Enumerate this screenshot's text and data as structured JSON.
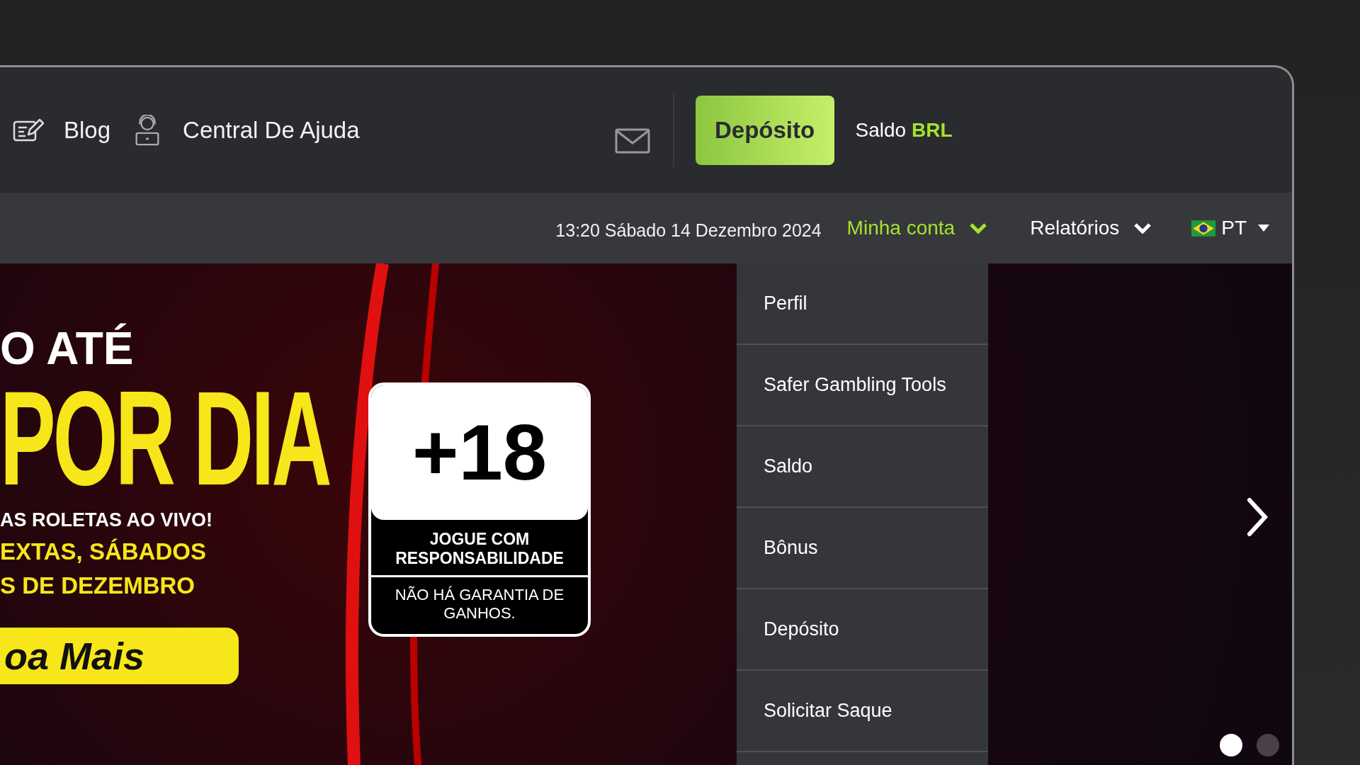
{
  "header": {
    "links": [
      {
        "label": "Blog"
      },
      {
        "label": "Central De Ajuda"
      }
    ],
    "deposit_button": "Depósito",
    "balance": {
      "label": "Saldo",
      "currency": "BRL"
    }
  },
  "subnav": {
    "datetime": "13:20 Sábado 14 Dezembro 2024",
    "menus": [
      {
        "label": "Minha conta",
        "selected": true
      },
      {
        "label": "Relatórios",
        "selected": false
      }
    ],
    "language": "PT"
  },
  "account_menu": {
    "items": [
      "Perfil",
      "Safer Gambling Tools",
      "Saldo",
      "Bônus",
      "Depósito",
      "Solicitar Saque"
    ]
  },
  "banner": {
    "headline": "O ATÉ",
    "amount_line": "POR DIA",
    "subtitle": "AS ROLETAS AO VIVO!",
    "dates": [
      "EXTAS, SÁBADOS",
      "S DE DEZEMBRO"
    ],
    "cta": "oa Mais",
    "age_badge": {
      "age": "+18",
      "message": "JOGUE COM RESPONSABILIDADE",
      "disclaimer": "NÃO HÁ GARANTIA DE GANHOS."
    }
  },
  "carousel": {
    "slides": [
      {
        "selected": true
      },
      {
        "selected": false
      }
    ]
  }
}
